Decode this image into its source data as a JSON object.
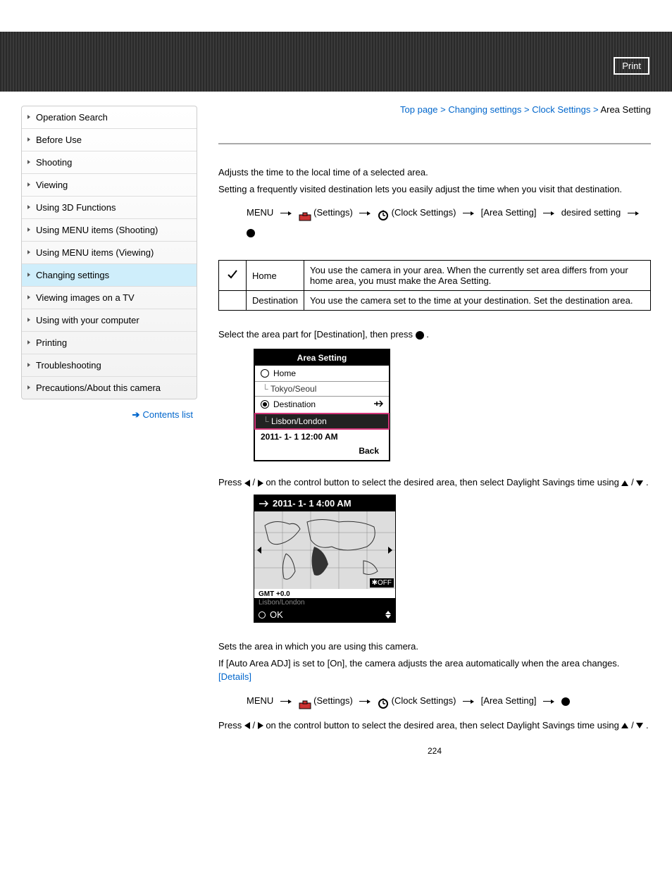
{
  "print_label": "Print",
  "breadcrumb": {
    "top": "Top page",
    "b1": "Changing settings",
    "b2": "Clock Settings",
    "current": "Area Setting"
  },
  "sidebar": {
    "items": [
      {
        "label": "Operation Search"
      },
      {
        "label": "Before Use"
      },
      {
        "label": "Shooting"
      },
      {
        "label": "Viewing"
      },
      {
        "label": "Using 3D Functions"
      },
      {
        "label": "Using MENU items (Shooting)"
      },
      {
        "label": "Using MENU items (Viewing)"
      },
      {
        "label": "Changing settings"
      },
      {
        "label": "Viewing images on a TV"
      },
      {
        "label": "Using with your computer"
      },
      {
        "label": "Printing"
      },
      {
        "label": "Troubleshooting"
      },
      {
        "label": "Precautions/About this camera"
      }
    ],
    "contents_label": "Contents list"
  },
  "intro": {
    "p1": "Adjusts the time to the local time of a selected area.",
    "p2": "Setting a frequently visited destination lets you easily adjust the time when you visit that destination."
  },
  "nav1": {
    "menu": "MENU",
    "settings": "(Settings)",
    "clock": "(Clock Settings)",
    "area": "[Area Setting]",
    "desired": "desired setting"
  },
  "table": {
    "r1_name": "Home",
    "r1_desc": "You use the camera in your area. When the currently set area differs from your home area, you must make the Area Setting.",
    "r2_name": "Destination",
    "r2_desc": "You use the camera set to the time at your destination. Set the destination area."
  },
  "instr1_a": "Select the area part for [Destination], then press ",
  "instr1_b": " .",
  "ss1": {
    "title": "Area Setting",
    "home": "Home",
    "home_city": "Tokyo/Seoul",
    "dest": "Destination",
    "dest_city": "Lisbon/London",
    "date": "2011-  1-  1 12:00 AM",
    "back": "Back"
  },
  "instr2_a": "Press ",
  "instr2_b": " / ",
  "instr2_c": " on the control button to select the desired area, then select Daylight Savings time using ",
  "instr2_d": " / ",
  "instr2_e": " .",
  "ss2": {
    "date": "2011-  1-  1   4:00 AM",
    "gmt": "GMT +0.0",
    "city": "Lisbon/London",
    "off": "OFF",
    "ok": "OK"
  },
  "sec3": {
    "p1": "Sets the area in which you are using this camera.",
    "p2a": "If [Auto Area ADJ] is set to [On], the camera adjusts the area automatically when the area changes. ",
    "details": "[Details]"
  },
  "page_number": "224"
}
